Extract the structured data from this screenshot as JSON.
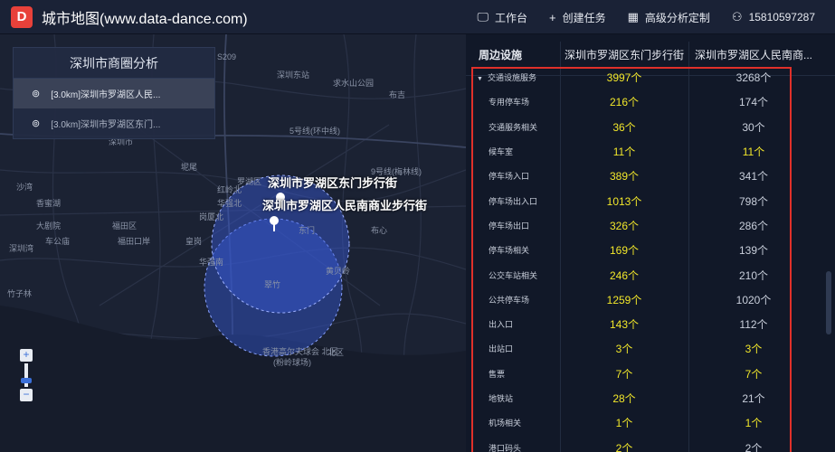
{
  "header": {
    "logo_letter": "D",
    "title": "城市地图(www.data-dance.com)",
    "nav": [
      {
        "icon": "monitor-icon",
        "glyph": "🖵",
        "label": "工作台"
      },
      {
        "icon": "plus-icon",
        "glyph": "+",
        "label": "创建任务"
      },
      {
        "icon": "calendar-icon",
        "glyph": "▦",
        "label": "高级分析定制"
      },
      {
        "icon": "user-icon",
        "glyph": "⚇",
        "label": "15810597287"
      }
    ]
  },
  "panel": {
    "title": "深圳市商圈分析",
    "items": [
      {
        "label": "[3.0km]深圳市罗湖区人民..."
      },
      {
        "label": "[3.0km]深圳市罗湖区东门..."
      }
    ]
  },
  "map": {
    "callouts": [
      "深圳市罗湖区东门步行街",
      "深圳市罗湖区人民南商业步行街"
    ],
    "labels": [
      "S209",
      "深圳东站",
      "求水山公园",
      "布吉",
      "深圳市",
      "5号线(环中线)",
      "9号线(梅林线)",
      "沙湾",
      "坭尾",
      "福田口岸",
      "深圳湾",
      "大剧院",
      "北区",
      "香港高尔夫球会 北区",
      "(粉岭球场)",
      "香蜜湖",
      "车公庙",
      "福田区",
      "皇岗",
      "罗湖区",
      "东门",
      "黄贝岭",
      "翠竹",
      "布心",
      "红岭北",
      "竹子林",
      "华强北",
      "华强南",
      "岗厦北"
    ]
  },
  "zoom": {
    "plus": "+",
    "minus": "−"
  },
  "table": {
    "headers": [
      "周边设施",
      "深圳市罗湖区东门步行街",
      "深圳市罗湖区人民南商..."
    ],
    "rows": [
      {
        "name": "交通设施服务",
        "a": "3997个",
        "b": "3268个",
        "group": true,
        "b_hl": false
      },
      {
        "name": "专用停车场",
        "a": "216个",
        "b": "174个",
        "b_hl": false
      },
      {
        "name": "交通服务相关",
        "a": "36个",
        "b": "30个",
        "b_hl": false
      },
      {
        "name": "候车室",
        "a": "11个",
        "b": "11个",
        "b_hl": true
      },
      {
        "name": "停车场入口",
        "a": "389个",
        "b": "341个",
        "b_hl": false
      },
      {
        "name": "停车场出入口",
        "a": "1013个",
        "b": "798个",
        "b_hl": false
      },
      {
        "name": "停车场出口",
        "a": "326个",
        "b": "286个",
        "b_hl": false
      },
      {
        "name": "停车场相关",
        "a": "169个",
        "b": "139个",
        "b_hl": false
      },
      {
        "name": "公交车站相关",
        "a": "246个",
        "b": "210个",
        "b_hl": false
      },
      {
        "name": "公共停车场",
        "a": "1259个",
        "b": "1020个",
        "b_hl": false
      },
      {
        "name": "出入口",
        "a": "143个",
        "b": "112个",
        "b_hl": false
      },
      {
        "name": "出站口",
        "a": "3个",
        "b": "3个",
        "b_hl": true
      },
      {
        "name": "售票",
        "a": "7个",
        "b": "7个",
        "b_hl": true
      },
      {
        "name": "地铁站",
        "a": "28个",
        "b": "21个",
        "b_hl": false
      },
      {
        "name": "机场相关",
        "a": "1个",
        "b": "1个",
        "b_hl": true
      },
      {
        "name": "港口码头",
        "a": "2个",
        "b": "2个",
        "b_hl": false
      }
    ]
  },
  "colors": {
    "accent_yellow": "#f2e72a",
    "highlight_red": "#e0302a",
    "circle_blue": "#3d5fd9",
    "logo_red": "#e8413a"
  }
}
